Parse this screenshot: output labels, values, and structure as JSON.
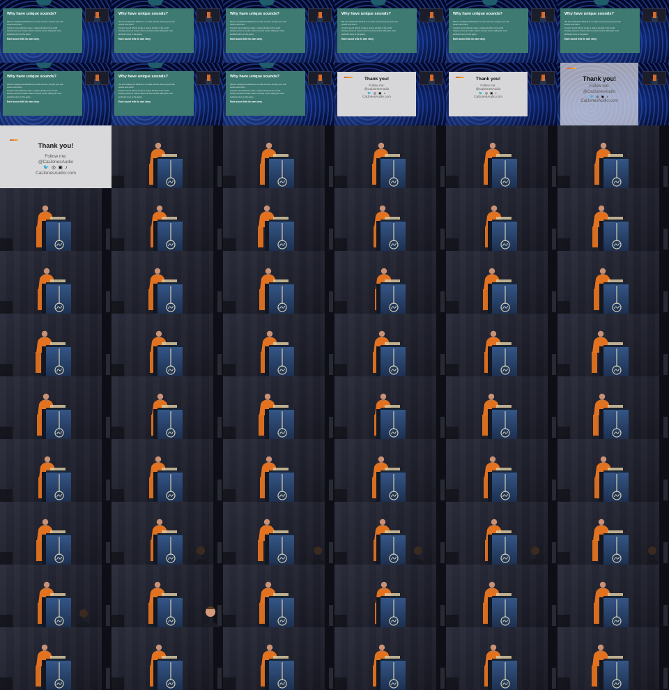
{
  "slide": {
    "title": "Why have unique sounds?",
    "body_lines": [
      "We are creating the lifeboat to re-make sounds, and put your own",
      "stories onto them.",
      "Content sound effects create a unique identity in the world.",
      "Having someone create custom sounds means telling the most",
      "authentic story to the game."
    ],
    "footer": "Each sound tells its own story."
  },
  "thankyou": {
    "title": "Thank you!",
    "follow": "Follow me:",
    "handle": "@CalJonesAudio",
    "icons": "🐦 ◎ ▣ ♪",
    "site": "CalJonesAudio.com"
  },
  "tiles": [
    "slide",
    "slide",
    "slide",
    "slide",
    "slide",
    "slide",
    "slide",
    "slide",
    "slide",
    "thankyou",
    "thankyou",
    "fade",
    "thankyou-full",
    "stage",
    "stage",
    "stage",
    "stage",
    "stage",
    "stage",
    "stage",
    "stage",
    "stage",
    "stage",
    "stage",
    "stage",
    "stage",
    "stage",
    "stage",
    "stage",
    "stage",
    "stage",
    "stage",
    "stage",
    "stage",
    "stage",
    "stage",
    "stage",
    "stage",
    "stage",
    "stage",
    "stage",
    "stage",
    "stage",
    "stage",
    "stage",
    "stage",
    "stage",
    "stage",
    "stage",
    "stage-aud",
    "stage-aud",
    "stage-aud",
    "stage-aud",
    "stage-aud",
    "stage-aud",
    "stage-aud2",
    "stage",
    "stage",
    "stage",
    "stage",
    "stage",
    "stage",
    "stage",
    "stage",
    "stage",
    "stage"
  ],
  "colors": {
    "stage_bg": "#1c1d29",
    "shirt": "#e2721f",
    "podium": "#2d4a70"
  }
}
